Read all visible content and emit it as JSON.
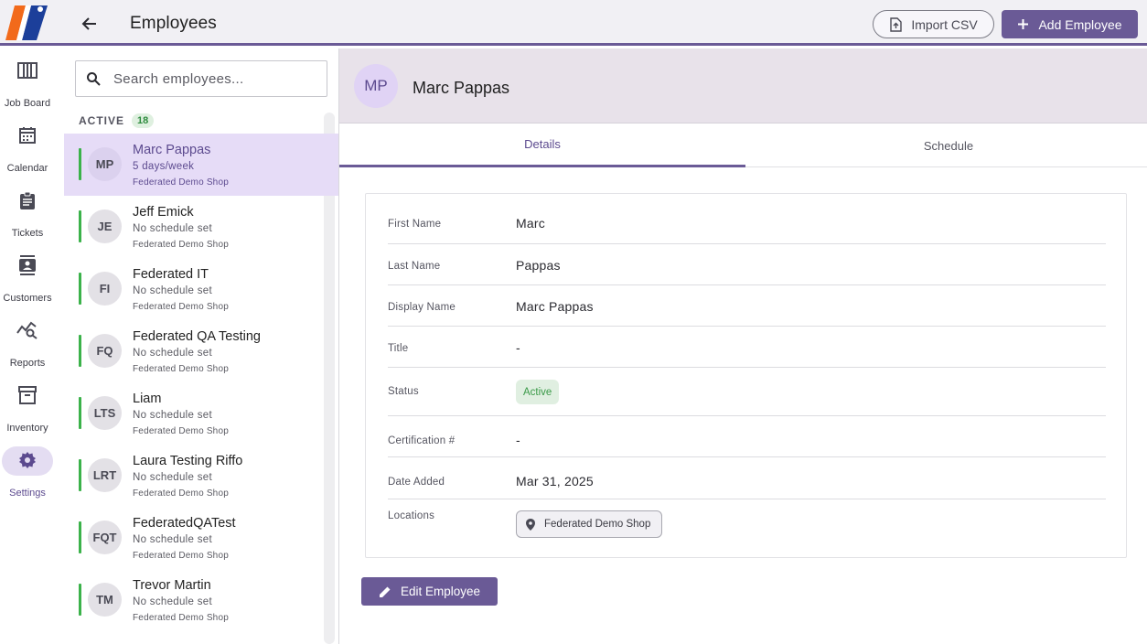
{
  "header": {
    "title": "Employees",
    "import_label": "Import CSV",
    "add_label": "Add Employee"
  },
  "nav": {
    "items": [
      {
        "label": "Job Board",
        "icon": "job-board-icon"
      },
      {
        "label": "Calendar",
        "icon": "calendar-icon"
      },
      {
        "label": "Tickets",
        "icon": "clipboard-icon"
      },
      {
        "label": "Customers",
        "icon": "contacts-icon"
      },
      {
        "label": "Reports",
        "icon": "analytics-icon"
      },
      {
        "label": "Inventory",
        "icon": "archive-box-icon"
      },
      {
        "label": "Settings",
        "icon": "gear-icon",
        "active": true
      }
    ]
  },
  "search": {
    "placeholder": "Search employees..."
  },
  "list": {
    "section_label": "ACTIVE",
    "count": "18",
    "employees": [
      {
        "initials": "MP",
        "name": "Marc Pappas",
        "schedule": "5 days/week",
        "shop": "Federated Demo Shop"
      },
      {
        "initials": "JE",
        "name": "Jeff Emick",
        "schedule": "No schedule set",
        "shop": "Federated Demo Shop"
      },
      {
        "initials": "FI",
        "name": "Federated IT",
        "schedule": "No schedule set",
        "shop": "Federated Demo Shop"
      },
      {
        "initials": "FQ",
        "name": "Federated QA Testing",
        "schedule": "No schedule set",
        "shop": "Federated Demo Shop"
      },
      {
        "initials": "LTS",
        "name": "Liam",
        "schedule": "No schedule set",
        "shop": "Federated Demo Shop"
      },
      {
        "initials": "LRT",
        "name": "Laura Testing Riffo",
        "schedule": "No schedule set",
        "shop": "Federated Demo Shop"
      },
      {
        "initials": "FQT",
        "name": "FederatedQATest",
        "schedule": "No schedule set",
        "shop": "Federated Demo Shop"
      },
      {
        "initials": "TM",
        "name": "Trevor Martin",
        "schedule": "No schedule set",
        "shop": "Federated Demo Shop"
      }
    ]
  },
  "detail": {
    "initials": "MP",
    "name": "Marc Pappas",
    "tabs": [
      {
        "label": "Details",
        "active": true
      },
      {
        "label": "Schedule",
        "active": false
      }
    ],
    "fields": {
      "first_name": {
        "label": "First Name",
        "value": "Marc"
      },
      "last_name": {
        "label": "Last Name",
        "value": "Pappas"
      },
      "display_name": {
        "label": "Display Name",
        "value": "Marc Pappas"
      },
      "title": {
        "label": "Title",
        "value": "-"
      },
      "status": {
        "label": "Status",
        "value": "Active"
      },
      "certification": {
        "label": "Certification #",
        "value": "-"
      },
      "date_added": {
        "label": "Date Added",
        "value": "Mar 31, 2025"
      },
      "locations": {
        "label": "Locations",
        "value": "Federated Demo Shop"
      }
    },
    "edit_label": "Edit Employee"
  },
  "colors": {
    "accent": "#6a5a96",
    "selected_bg": "#e6dcf7",
    "active_green": "#3bb24a"
  }
}
